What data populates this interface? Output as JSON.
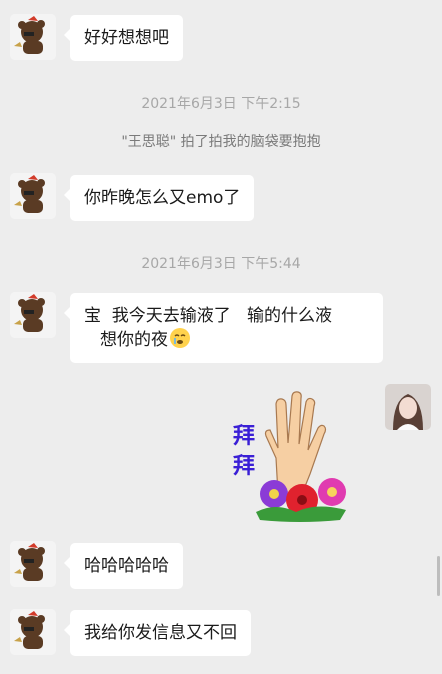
{
  "messages": [
    {
      "text": "好好想想吧"
    },
    {
      "text": "你昨晚怎么又emo了"
    },
    {
      "line1": "宝  我今天去输液了   输的什么液",
      "line2": "想你的夜"
    },
    {
      "text": "哈哈哈哈哈"
    },
    {
      "text": "我给你发信息又不回"
    }
  ],
  "timestamps": [
    "2021年6月3日 下午2:15",
    "2021年6月3日 下午5:44"
  ],
  "system_notice": "\"王思聪\" 拍了拍我的脑袋要抱抱",
  "sticker": {
    "text_line1": "拜",
    "text_line2": "拜"
  },
  "icons": {
    "contact_avatar": "bear-avatar-icon",
    "self_avatar": "girl-avatar-icon",
    "emoji": "crying-emoji-icon",
    "sticker": "waving-hand-flowers-icon"
  }
}
